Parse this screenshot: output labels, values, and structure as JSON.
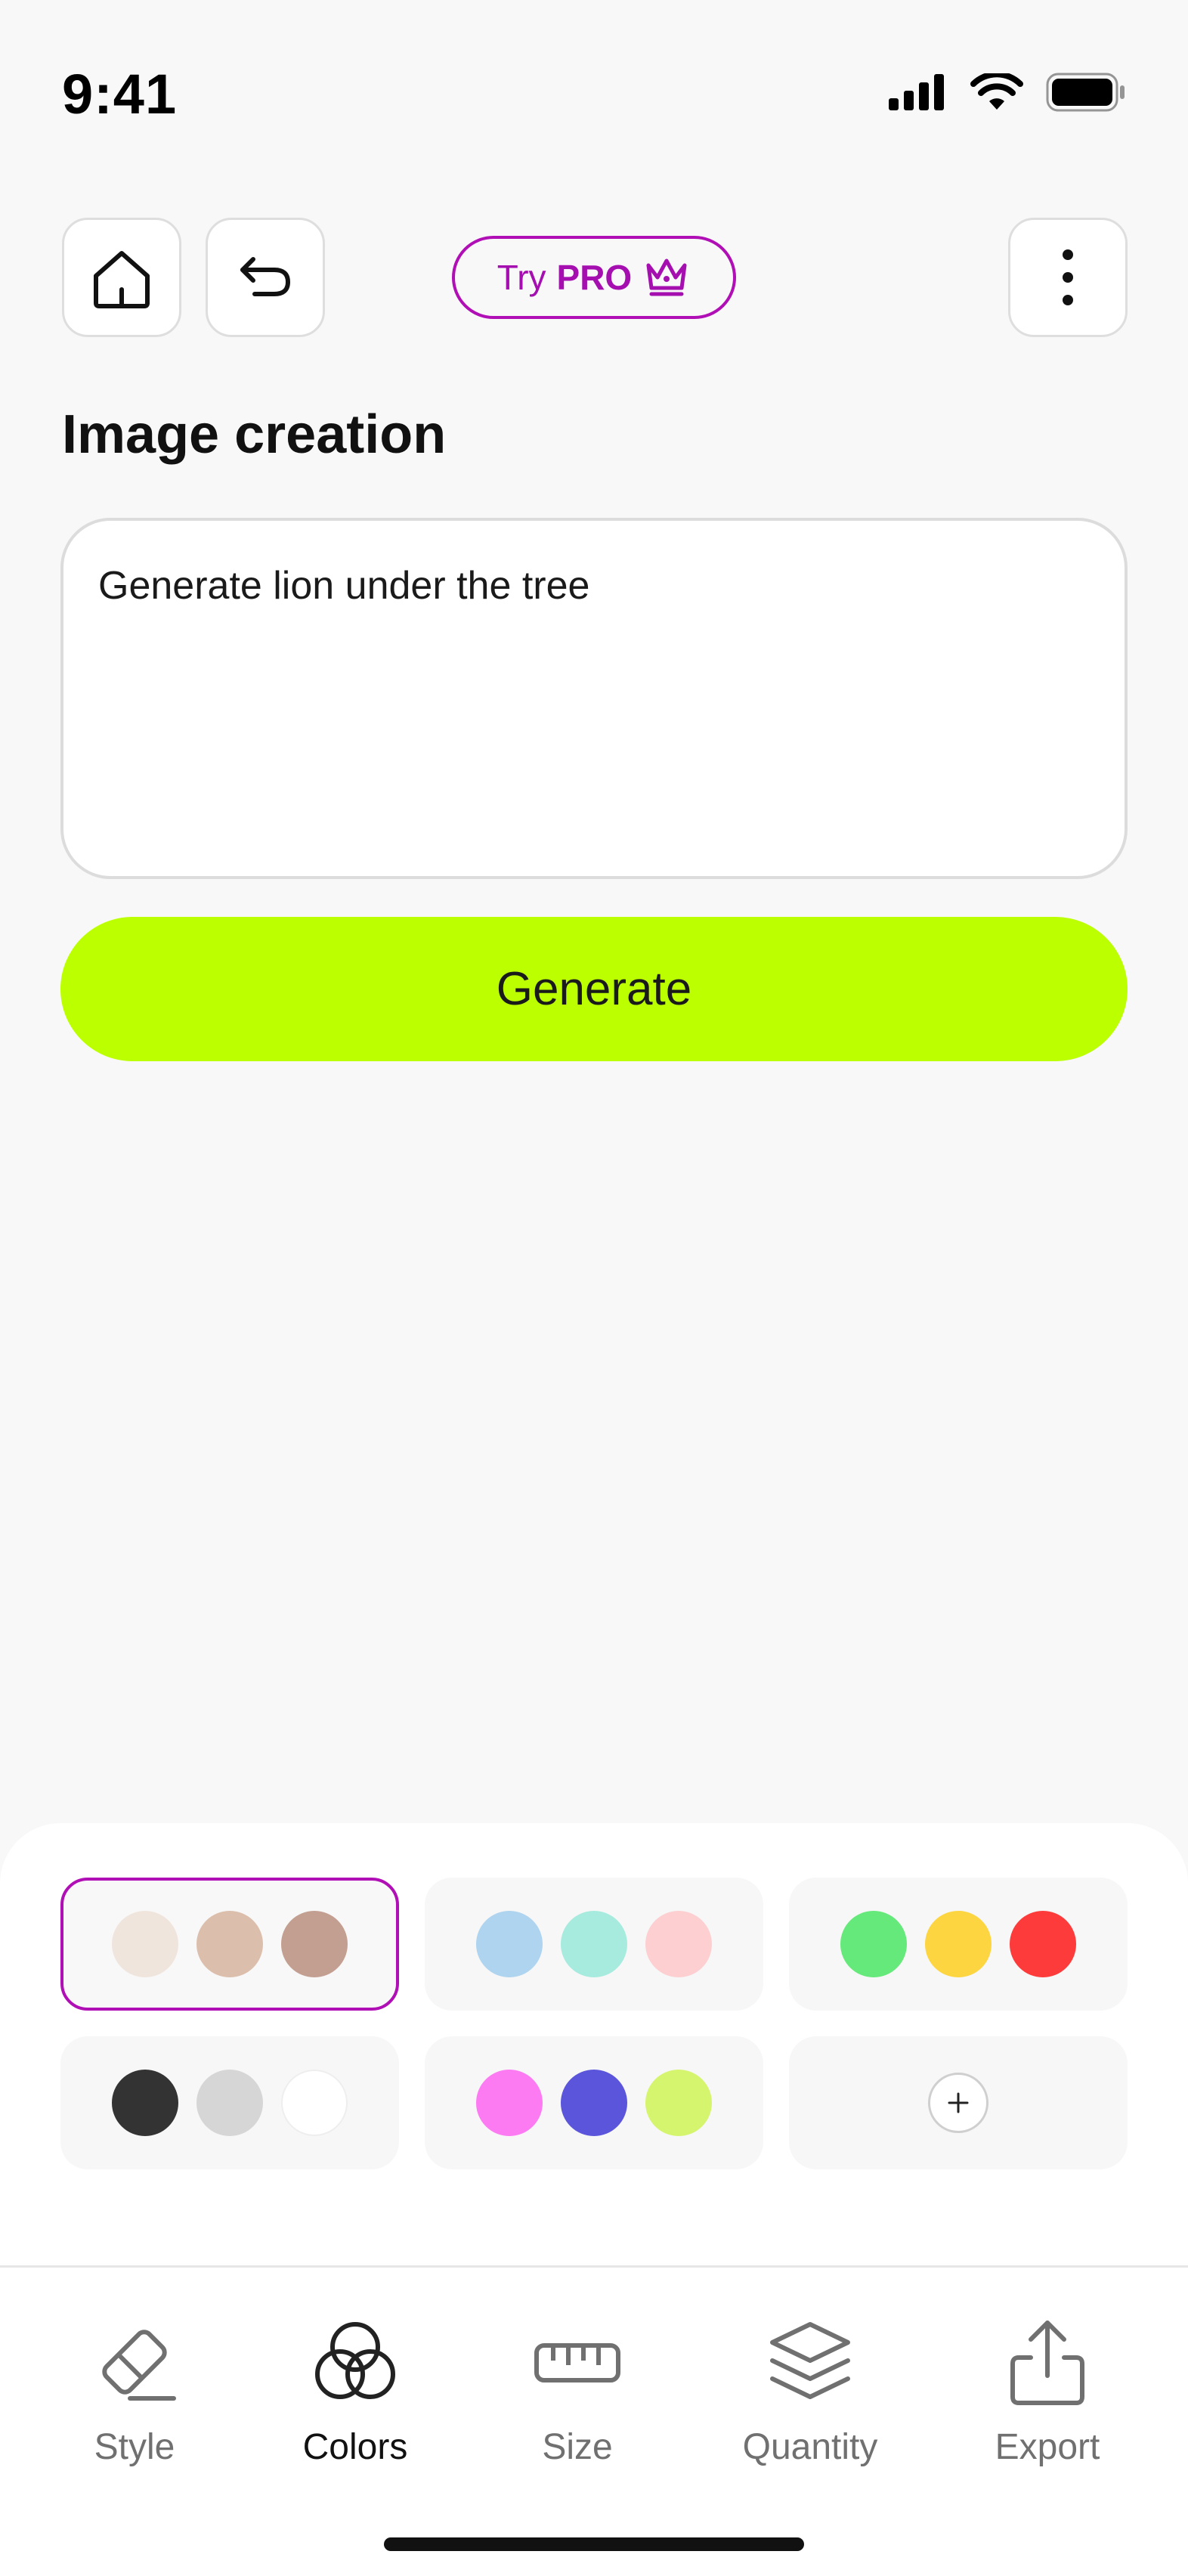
{
  "status_bar": {
    "time": "9:41"
  },
  "toolbar": {
    "home_icon": "home-icon",
    "undo_icon": "undo-icon",
    "more_icon": "more-vertical-icon",
    "pro_prefix": "Try",
    "pro_label": "PRO",
    "pro_icon": "crown-icon",
    "pro_color": "#b10fb6"
  },
  "main": {
    "title": "Image creation",
    "prompt_value": "Generate lion under the tree",
    "generate_label": "Generate",
    "generate_color": "#bbff00"
  },
  "palettes": [
    {
      "colors": [
        "#f0e5dd",
        "#dbbfac",
        "#c39f91"
      ],
      "selected": true
    },
    {
      "colors": [
        "#aed4ef",
        "#a6ebde",
        "#fdcfd1"
      ],
      "selected": false
    },
    {
      "colors": [
        "#65e97b",
        "#fcd541",
        "#fe3b3b"
      ],
      "selected": false
    },
    {
      "colors": [
        "#333333",
        "#d6d6d6",
        "#ffffff"
      ],
      "selected": false
    },
    {
      "colors": [
        "#fc7bf2",
        "#5a55db",
        "#d5f56f"
      ],
      "selected": false
    },
    {
      "add": true,
      "icon": "plus-icon"
    }
  ],
  "tabs": [
    {
      "label": "Style",
      "icon": "eraser-icon",
      "active": false
    },
    {
      "label": "Colors",
      "icon": "colors-icon",
      "active": true
    },
    {
      "label": "Size",
      "icon": "ruler-icon",
      "active": false
    },
    {
      "label": "Quantity",
      "icon": "layers-icon",
      "active": false
    },
    {
      "label": "Export",
      "icon": "share-icon",
      "active": false
    }
  ]
}
